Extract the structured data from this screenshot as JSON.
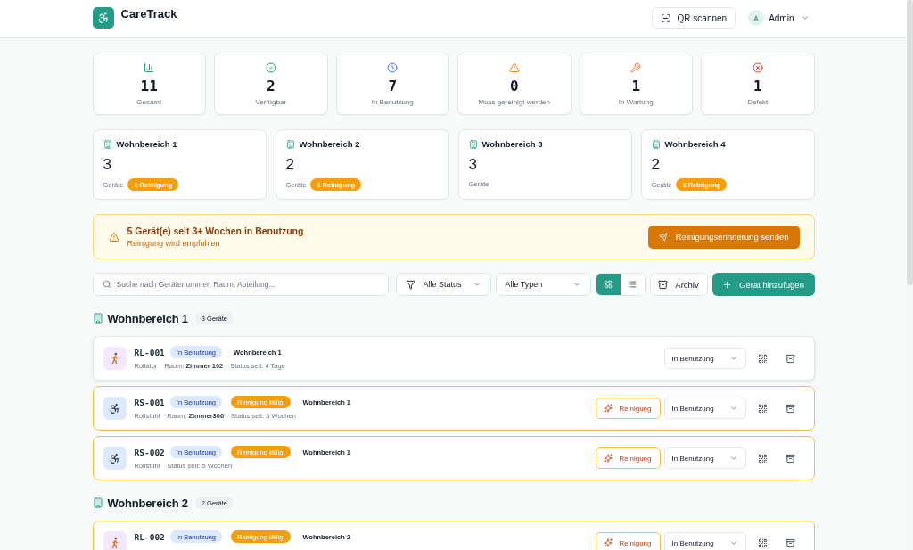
{
  "header": {
    "logo": "CareTrack",
    "qr_button": "QR scannen",
    "user": {
      "initial": "A",
      "name": "Admin"
    }
  },
  "stats": [
    {
      "kind": "total",
      "value": "11",
      "label": "Gesamt"
    },
    {
      "kind": "available",
      "value": "2",
      "label": "Verfügbar"
    },
    {
      "kind": "in_use",
      "value": "7",
      "label": "In Benutzung"
    },
    {
      "kind": "cleaning",
      "value": "0",
      "label": "Muss gereinigt werden"
    },
    {
      "kind": "maintenance",
      "value": "1",
      "label": "In Wartung"
    },
    {
      "kind": "defect",
      "value": "1",
      "label": "Defekt"
    }
  ],
  "areas": [
    {
      "name": "Wohnbereich 1",
      "count": "3",
      "unit": "Geräte",
      "badge": "2 Reinigung"
    },
    {
      "name": "Wohnbereich 2",
      "count": "2",
      "unit": "Geräte",
      "badge": "1 Reinigung"
    },
    {
      "name": "Wohnbereich 3",
      "count": "3",
      "unit": "Geräte"
    },
    {
      "name": "Wohnbereich 4",
      "count": "2",
      "unit": "Geräte",
      "badge": "1 Reinigung"
    }
  ],
  "alert": {
    "title": "5 Gerät(e) seit 3+ Wochen in Benutzung",
    "subtitle": "Reinigung wird empfohlen",
    "button": "Reinigungserinnerung senden"
  },
  "toolbar": {
    "search": {
      "placeholder": "Suche nach Gerätenummer, Raum, Abteilung..."
    },
    "filters": [
      {
        "kind": "status",
        "label": "Alle Status"
      },
      {
        "kind": "type",
        "label": "Alle Typen"
      }
    ],
    "views": [
      {
        "kind": "grid",
        "selected": true
      },
      {
        "kind": "list",
        "selected": false
      }
    ],
    "archive_button": "Archiv",
    "add_button": "Gerät hinzufügen"
  },
  "groups": [
    {
      "name": "Wohnbereich 1",
      "count": "3 Geräte",
      "devices": [
        {
          "kind": "rollator",
          "code": "RL-001",
          "status": "In Benutzung",
          "due": false,
          "area": "Wohnbereich 1",
          "type": "Rollator",
          "room": "Raum: **Zimmer 102**",
          "since": "Status seit: 4 Tage",
          "select": "In Benutzung"
        },
        {
          "kind": "wheelchair",
          "code": "RS-001",
          "status": "In Benutzung",
          "due": true,
          "due_badge": "Reinigung fällig!",
          "area": "Wohnbereich 1",
          "type": "Rollstuhl",
          "room": "Raum: **Zimmer306**",
          "since": "Status seit: 5 Wochen",
          "clean_button": "Reinigung",
          "select": "In Benutzung"
        },
        {
          "kind": "wheelchair",
          "code": "RS-002",
          "status": "In Benutzung",
          "due": true,
          "due_badge": "Reinigung fällig!",
          "area": "Wohnbereich 1",
          "type": "Rollstuhl",
          "since": "Status seit: 5 Wochen",
          "clean_button": "Reinigung",
          "select": "In Benutzung"
        }
      ]
    },
    {
      "name": "Wohnbereich 2",
      "count": "2 Geräte",
      "devices": [
        {
          "kind": "rollator",
          "code": "RL-002",
          "status": "In Benutzung",
          "due": true,
          "due_badge": "Reinigung fällig!",
          "area": "Wohnbereich 2",
          "clean_button": "Reinigung",
          "select": "In Benutzung"
        }
      ]
    }
  ]
}
